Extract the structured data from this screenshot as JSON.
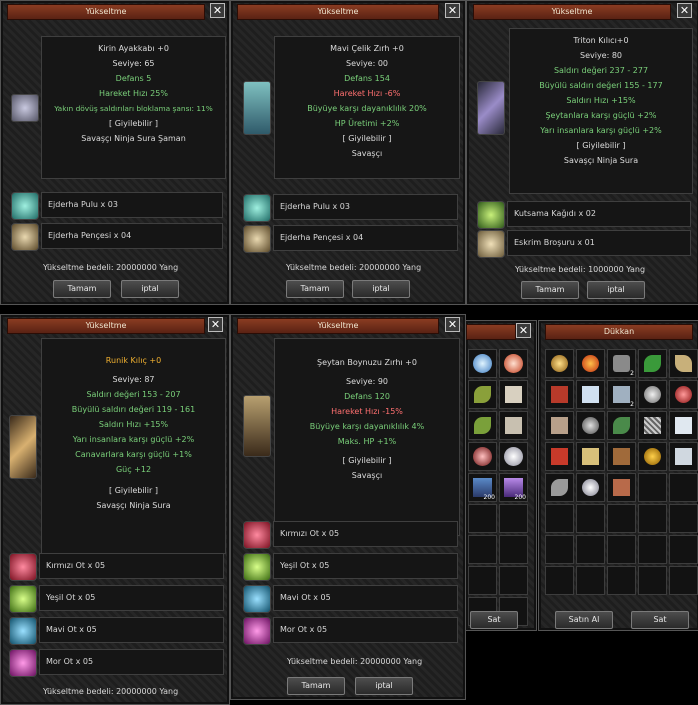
{
  "windows": [
    {
      "title": "Yükseltme",
      "lines": [
        {
          "text": "Kirin Ayakkabı +0",
          "color": "w"
        },
        {
          "text": "Seviye: 65",
          "color": "w"
        },
        {
          "text": "Defans 5",
          "color": "g"
        },
        {
          "text": "Hareket Hızı 25%",
          "color": "g"
        },
        {
          "text": "Yakın dövüş saldırıları bloklama şansı: 11%",
          "color": "g"
        },
        {
          "text": "[ Giyilebilir ]",
          "color": "w"
        },
        {
          "text": "Savaşçı Ninja Sura Şaman",
          "color": "w"
        }
      ],
      "materials": [
        "Ejderha Pulu x 03",
        "Ejderha Pençesi x 04"
      ],
      "cost": "Yükseltme bedeli: 20000000 Yang",
      "ok": "Tamam",
      "cancel": "iptal"
    },
    {
      "title": "Yükseltme",
      "lines": [
        {
          "text": "Mavi Çelik Zırh +0",
          "color": "w"
        },
        {
          "text": "Seviye: 00",
          "color": "w"
        },
        {
          "text": "Defans 154",
          "color": "g"
        },
        {
          "text": "Hareket Hızı -6%",
          "color": "r"
        },
        {
          "text": "Büyüye karşı dayanıklılık 20%",
          "color": "g"
        },
        {
          "text": "HP Üretimi +2%",
          "color": "g"
        },
        {
          "text": "[ Giyilebilir ]",
          "color": "w"
        },
        {
          "text": "Savaşçı",
          "color": "w"
        }
      ],
      "materials": [
        "Ejderha Pulu x 03",
        "Ejderha Pençesi x 04"
      ],
      "cost": "Yükseltme bedeli: 20000000 Yang",
      "ok": "Tamam",
      "cancel": "iptal"
    },
    {
      "title": "Yükseltme",
      "lines": [
        {
          "text": "Triton Kılıcı+0",
          "color": "w"
        },
        {
          "text": "Seviye: 80",
          "color": "w"
        },
        {
          "text": "Saldırı değeri 237 - 277",
          "color": "g"
        },
        {
          "text": "Büyülü saldırı değeri 155 - 177",
          "color": "g"
        },
        {
          "text": "Saldırı Hızı +15%",
          "color": "g"
        },
        {
          "text": "Şeytanlara karşı güçlü +2%",
          "color": "g"
        },
        {
          "text": "Yarı insanlara karşı güçlü +2%",
          "color": "g"
        },
        {
          "text": "[ Giyilebilir ]",
          "color": "w"
        },
        {
          "text": "Savaşçı Ninja Sura",
          "color": "w"
        }
      ],
      "materials": [
        "Kutsama Kağıdı x 02",
        "Eskrim Broşuru x 01"
      ],
      "cost": "Yükseltme bedeli: 1000000 Yang",
      "ok": "Tamam",
      "cancel": "iptal"
    },
    {
      "title": "Yükseltme",
      "lines": [
        {
          "text": "Runik Kılıç +0",
          "color": "o"
        },
        {
          "text": "Seviye: 87",
          "color": "w"
        },
        {
          "text": "Saldırı değeri 153 - 207",
          "color": "g"
        },
        {
          "text": "Büyülü saldırı değeri 119 - 161",
          "color": "g"
        },
        {
          "text": "Saldırı Hızı +15%",
          "color": "g"
        },
        {
          "text": "Yarı insanlara karşı güçlü +2%",
          "color": "g"
        },
        {
          "text": "Canavarlara karşı güçlü +1%",
          "color": "g"
        },
        {
          "text": "Güç +12",
          "color": "g"
        },
        {
          "text": "[ Giyilebilir ]",
          "color": "w"
        },
        {
          "text": "Savaşçı Ninja Sura",
          "color": "w"
        }
      ],
      "materials": [
        "Kırmızı Ot x 05",
        "Yeşil Ot x 05",
        "Mavi Ot x 05",
        "Mor Ot x 05"
      ],
      "cost": "Yükseltme bedeli: 20000000 Yang"
    },
    {
      "title": "Yükseltme",
      "lines": [
        {
          "text": "Şeytan Boynuzu Zırhı +0",
          "color": "w"
        },
        {
          "text": "Seviye: 90",
          "color": "w"
        },
        {
          "text": "Defans 120",
          "color": "g"
        },
        {
          "text": "Hareket Hızı -15%",
          "color": "r"
        },
        {
          "text": "Büyüye karşı dayanıklılık 4%",
          "color": "g"
        },
        {
          "text": "Maks. HP +1%",
          "color": "g"
        },
        {
          "text": "[ Giyilebilir ]",
          "color": "w"
        },
        {
          "text": "Savaşçı",
          "color": "w"
        }
      ],
      "materials": [
        "Kırmızı Ot x 05",
        "Yeşil Ot x 05",
        "Mavi Ot x 05",
        "Mor Ot x 05"
      ],
      "cost": "Yükseltme bedeli: 20000000 Yang",
      "ok": "Tamam",
      "cancel": "iptal"
    }
  ],
  "shop_left": {
    "sell": "Sat",
    "stack_labels": [
      "200",
      "200"
    ]
  },
  "shop_right": {
    "title": "Dükkan",
    "buy": "Satın Al",
    "sell": "Sat",
    "stack_labels": [
      "2",
      "2"
    ]
  },
  "material_colors": {
    "Ejderha Pulu": "#3fa6a0",
    "Ejderha Pençesi": "#b89b70",
    "Kutsama Kağıdı": "#6bbf3a",
    "Eskrim Broşuru": "#c8b58a",
    "Kırmızı Ot": "#e0304c",
    "Yeşil Ot": "#8fd23a",
    "Mavi Ot": "#3aa8d8",
    "Mor Ot": "#c848b8"
  },
  "close_glyph": "✕"
}
